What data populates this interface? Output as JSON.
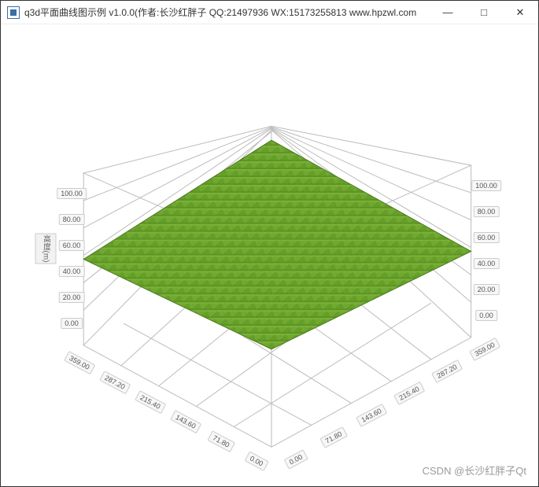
{
  "window": {
    "title": "q3d平面曲线图示例 v1.0.0(作者:长沙红胖子 QQ:21497936 WX:15173255813 www.hpzwl.com"
  },
  "winbuttons": {
    "min": "—",
    "max": "□",
    "close": "✕"
  },
  "watermark": "CSDN @长沙红胖子Qt",
  "chart_data": {
    "type": "surface3d",
    "title": "",
    "z_axis": {
      "label": "高度(m)",
      "ticks": [
        "0.00",
        "20.00",
        "40.00",
        "60.00",
        "80.00",
        "100.00"
      ],
      "range": [
        0,
        100
      ]
    },
    "z_axis_right": {
      "ticks": [
        "0.00",
        "20.00",
        "40.00",
        "60.00",
        "80.00",
        "100.00"
      ],
      "range": [
        0,
        100
      ]
    },
    "x_axis": {
      "label": "",
      "ticks": [
        "0.00",
        "71.80",
        "143.60",
        "215.40",
        "287.20",
        "359.00"
      ],
      "range": [
        0,
        359
      ]
    },
    "y_axis": {
      "label": "",
      "ticks": [
        "0.00",
        "71.80",
        "143.60",
        "215.40",
        "287.20",
        "359.00"
      ],
      "range": [
        0,
        359
      ]
    },
    "surface": {
      "color": "#6aa22a",
      "z_value": 50,
      "grid": {
        "rows": 40,
        "cols": 40
      }
    }
  }
}
